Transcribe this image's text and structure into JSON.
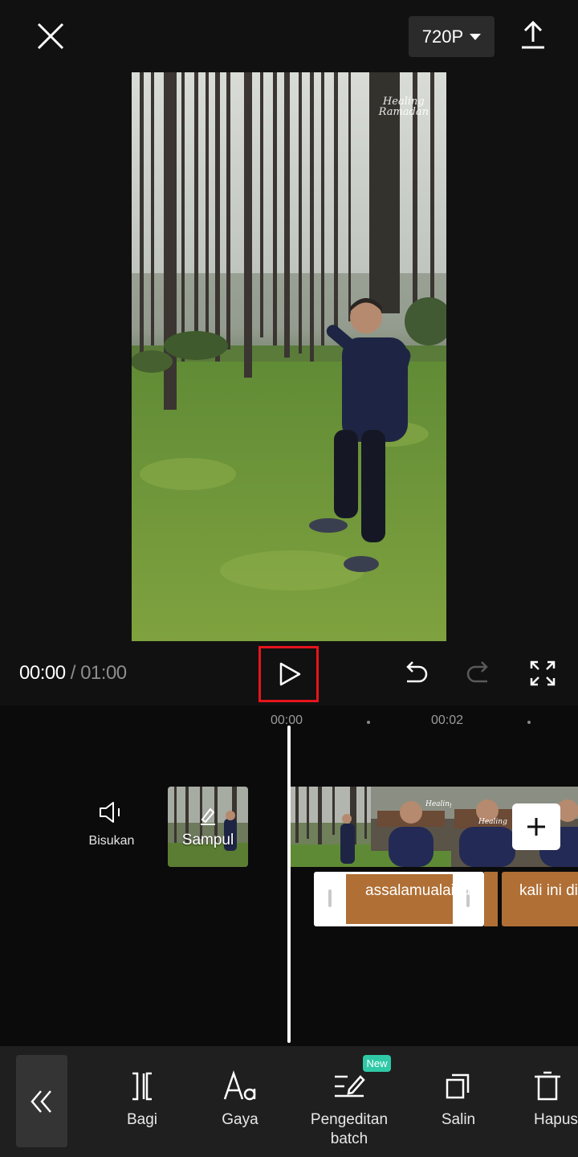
{
  "header": {
    "resolution": "720P",
    "close_icon": "close-icon",
    "export_icon": "upload-icon"
  },
  "preview": {
    "watermark_line1": "Healing",
    "watermark_line2": "Ramadan"
  },
  "transport": {
    "current_time": "00:00",
    "separator": "/",
    "total_time": "01:00",
    "highlight_color": "#e8141c"
  },
  "timeline": {
    "ruler": [
      "00:00",
      "00:02"
    ],
    "mute_label": "Bisukan",
    "cover_label": "Sampul",
    "captions": [
      {
        "text": "assalamualaikum",
        "selected": true
      },
      {
        "text": "kali ini di",
        "selected": false
      }
    ],
    "caption_color": "#b06f35"
  },
  "toolbar": {
    "items": [
      {
        "label": "Bagi",
        "icon": "split-icon"
      },
      {
        "label": "Gaya",
        "icon": "text-style-icon"
      },
      {
        "label": "Pengeditan batch",
        "icon": "batch-edit-icon",
        "badge": "New"
      },
      {
        "label": "Salin",
        "icon": "copy-icon"
      },
      {
        "label": "Hapus",
        "icon": "delete-icon"
      }
    ],
    "badge_color": "#2fc9a7"
  }
}
